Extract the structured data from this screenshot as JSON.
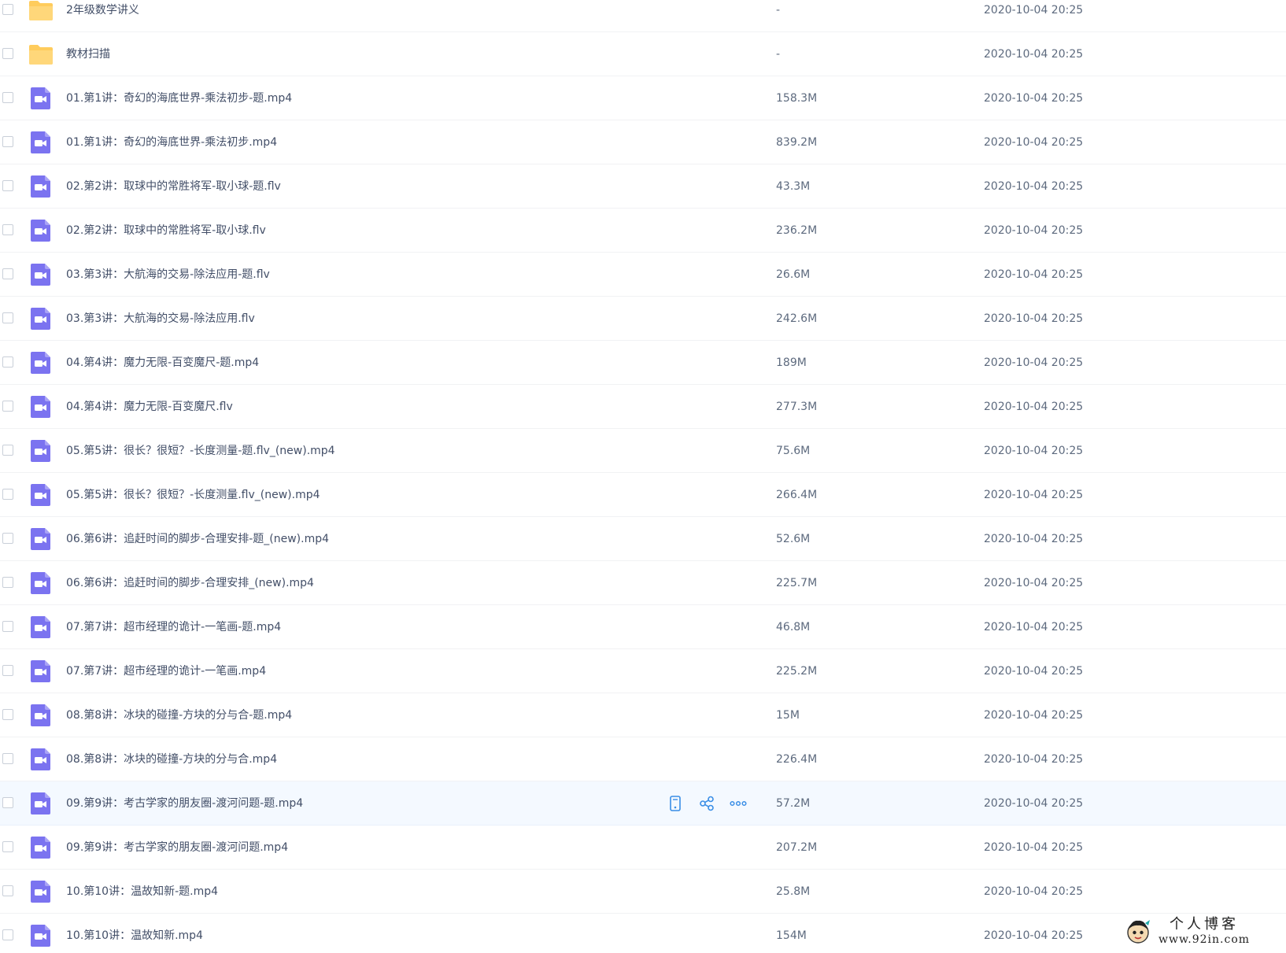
{
  "files": [
    {
      "type": "folder",
      "name": "2年级数学讲义",
      "size": "-",
      "modified": "2020-10-04 20:25"
    },
    {
      "type": "folder",
      "name": "教材扫描",
      "size": "-",
      "modified": "2020-10-04 20:25"
    },
    {
      "type": "video",
      "name": "01.第1讲：奇幻的海底世界-乘法初步-题.mp4",
      "size": "158.3M",
      "modified": "2020-10-04 20:25"
    },
    {
      "type": "video",
      "name": "01.第1讲：奇幻的海底世界-乘法初步.mp4",
      "size": "839.2M",
      "modified": "2020-10-04 20:25"
    },
    {
      "type": "video",
      "name": "02.第2讲：取球中的常胜将军-取小球-题.flv",
      "size": "43.3M",
      "modified": "2020-10-04 20:25"
    },
    {
      "type": "video",
      "name": "02.第2讲：取球中的常胜将军-取小球.flv",
      "size": "236.2M",
      "modified": "2020-10-04 20:25"
    },
    {
      "type": "video",
      "name": "03.第3讲：大航海的交易-除法应用-题.flv",
      "size": "26.6M",
      "modified": "2020-10-04 20:25"
    },
    {
      "type": "video",
      "name": "03.第3讲：大航海的交易-除法应用.flv",
      "size": "242.6M",
      "modified": "2020-10-04 20:25"
    },
    {
      "type": "video",
      "name": "04.第4讲：魔力无限-百变魔尺-题.mp4",
      "size": "189M",
      "modified": "2020-10-04 20:25"
    },
    {
      "type": "video",
      "name": "04.第4讲：魔力无限-百变魔尺.flv",
      "size": "277.3M",
      "modified": "2020-10-04 20:25"
    },
    {
      "type": "video",
      "name": "05.第5讲：很长？很短？-长度测量-题.flv_(new).mp4",
      "size": "75.6M",
      "modified": "2020-10-04 20:25"
    },
    {
      "type": "video",
      "name": "05.第5讲：很长？很短？-长度测量.flv_(new).mp4",
      "size": "266.4M",
      "modified": "2020-10-04 20:25"
    },
    {
      "type": "video",
      "name": "06.第6讲：追赶时间的脚步-合理安排-题_(new).mp4",
      "size": "52.6M",
      "modified": "2020-10-04 20:25"
    },
    {
      "type": "video",
      "name": "06.第6讲：追赶时间的脚步-合理安排_(new).mp4",
      "size": "225.7M",
      "modified": "2020-10-04 20:25"
    },
    {
      "type": "video",
      "name": "07.第7讲：超市经理的诡计-一笔画-题.mp4",
      "size": "46.8M",
      "modified": "2020-10-04 20:25"
    },
    {
      "type": "video",
      "name": "07.第7讲：超市经理的诡计-一笔画.mp4",
      "size": "225.2M",
      "modified": "2020-10-04 20:25"
    },
    {
      "type": "video",
      "name": "08.第8讲：冰块的碰撞-方块的分与合-题.mp4",
      "size": "15M",
      "modified": "2020-10-04 20:25"
    },
    {
      "type": "video",
      "name": "08.第8讲：冰块的碰撞-方块的分与合.mp4",
      "size": "226.4M",
      "modified": "2020-10-04 20:25"
    },
    {
      "type": "video",
      "name": "09.第9讲：考古学家的朋友圈-渡河问题-题.mp4",
      "size": "57.2M",
      "modified": "2020-10-04 20:25",
      "hovered": true
    },
    {
      "type": "video",
      "name": "09.第9讲：考古学家的朋友圈-渡河问题.mp4",
      "size": "207.2M",
      "modified": "2020-10-04 20:25"
    },
    {
      "type": "video",
      "name": "10.第10讲：温故知新-题.mp4",
      "size": "25.8M",
      "modified": "2020-10-04 20:25"
    },
    {
      "type": "video",
      "name": "10.第10讲：温故知新.mp4",
      "size": "154M",
      "modified": "2020-10-04 20:25"
    }
  ],
  "row_actions": [
    "phone-icon",
    "share-icon",
    "more-icon"
  ],
  "icons": {
    "folder": "folder-icon",
    "video": "video-file-icon"
  },
  "colors": {
    "folder": "#ffcc5c",
    "video": "#7b73f0",
    "action": "#3a8ee6",
    "hover_row": "#f4f9ff"
  },
  "watermark": {
    "title": "个人博客",
    "url": "www.92in.com"
  }
}
